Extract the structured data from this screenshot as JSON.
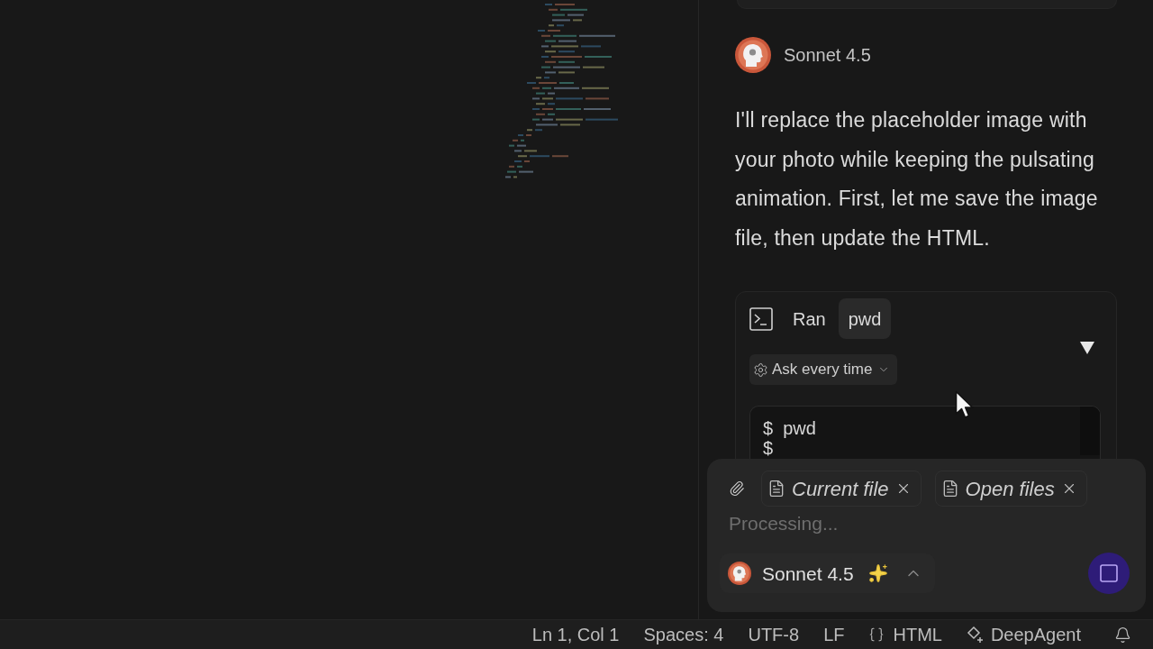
{
  "chat": {
    "message": {
      "author": "Sonnet 4.5",
      "text": "I'll replace the placeholder image with your photo while keeping the pulsating animation. First, let me save the image file, then update the HTML."
    },
    "tool_call": {
      "action": "Ran",
      "command": "pwd",
      "permission": "Ask every time",
      "terminal": [
        {
          "prompt": "$",
          "command": "pwd"
        },
        {
          "prompt": "$"
        }
      ]
    }
  },
  "composer": {
    "context": [
      {
        "label": "Current file"
      },
      {
        "label": "Open files"
      }
    ],
    "placeholder": "Processing...",
    "model": "Sonnet 4.5"
  },
  "status_bar": {
    "items": [
      {
        "kind": "text",
        "label": "Ln 1, Col 1"
      },
      {
        "kind": "text",
        "label": "Spaces: 4"
      },
      {
        "kind": "text",
        "label": "UTF-8"
      },
      {
        "kind": "text",
        "label": "LF"
      },
      {
        "kind": "language",
        "label": "HTML"
      },
      {
        "kind": "agent",
        "label": "DeepAgent"
      }
    ]
  }
}
